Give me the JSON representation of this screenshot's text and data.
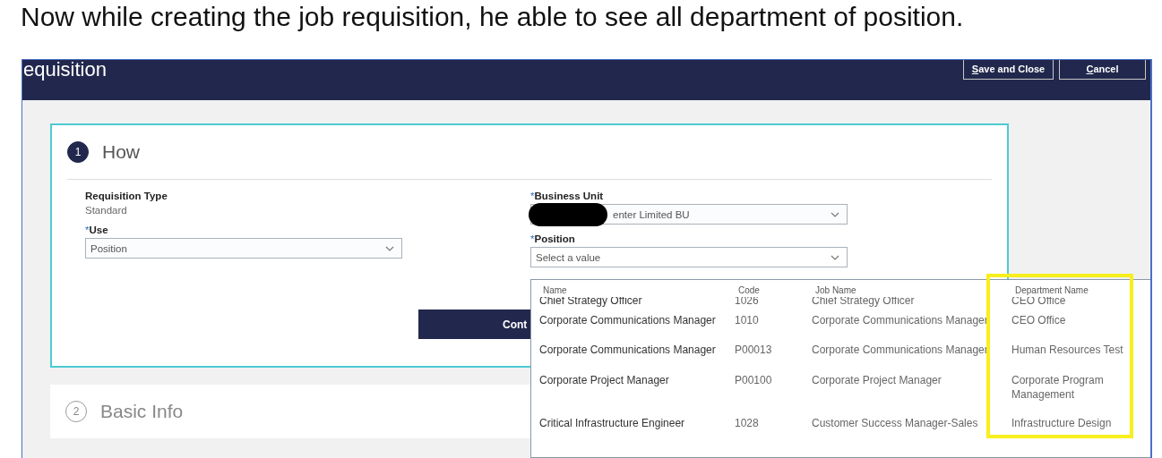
{
  "caption": "Now while creating the job requisition, he able to see all department of position.",
  "header": {
    "title": "equisition",
    "buttons": [
      "Save and Close",
      "Cancel"
    ]
  },
  "steps": [
    {
      "number": "1",
      "title": "How",
      "expanded": true
    },
    {
      "number": "2",
      "title": "Basic Info",
      "expanded": false
    }
  ],
  "fields": {
    "left": [
      {
        "kind": "readonly",
        "label": "Requisition Type",
        "value": "Standard"
      },
      {
        "kind": "select",
        "label": "Use",
        "required_mark": "*",
        "value": "Position"
      }
    ],
    "right": [
      {
        "kind": "select",
        "label": "Business Unit",
        "required_mark": "*",
        "value": "enter Limited BU",
        "redacted": true
      },
      {
        "kind": "select",
        "label": "Position",
        "required_mark": "*",
        "placeholder": "Select a value"
      }
    ]
  },
  "continue_button": "Cont",
  "dropdown": {
    "columns": [
      {
        "label": "Name",
        "highlighted": false
      },
      {
        "label": "Code",
        "highlighted": false
      },
      {
        "label": "Job Name",
        "highlighted": false
      },
      {
        "label": "Department Name",
        "highlighted": true
      }
    ],
    "rows": [
      [
        "Chief Strategy Officer",
        "1026",
        "Chief Strategy Officer",
        "CEO Office"
      ],
      [
        "Corporate Communications Manager",
        "1010",
        "Corporate Communications Manager",
        "CEO Office"
      ],
      [
        "Corporate Communications Manager",
        "P00013",
        "Corporate Communications Manager",
        "Human Resources Test"
      ],
      [
        "Corporate Project Manager",
        "P00100",
        "Corporate Project Manager",
        "Corporate Program Management"
      ],
      [
        "Critical Infrastructure Engineer",
        "1028",
        "Customer Success Manager-Sales",
        "Infrastructure Design"
      ]
    ]
  }
}
